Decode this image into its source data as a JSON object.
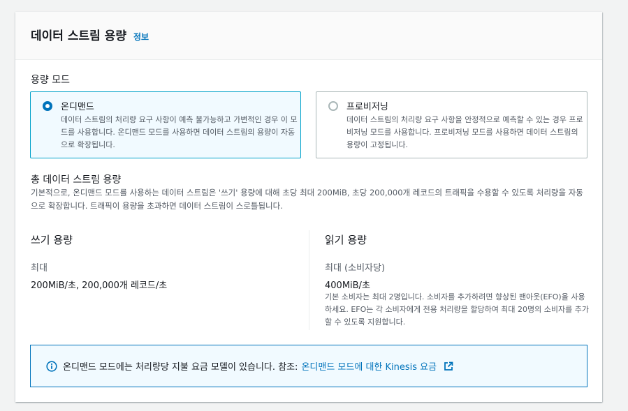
{
  "panel": {
    "title": "데이터 스트림 용량",
    "info_link": "정보"
  },
  "capacity_mode": {
    "label": "용량 모드",
    "options": [
      {
        "title": "온디맨드",
        "description": "데이터 스트림의 처리량 요구 사항이 예측 불가능하고 가변적인 경우 이 모드를 사용합니다. 온디맨드 모드를 사용하면 데이터 스트림의 용량이 자동으로 확장됩니다.",
        "selected": true
      },
      {
        "title": "프로비저닝",
        "description": "데이터 스트림의 처리량 요구 사항을 안정적으로 예측할 수 있는 경우 프로비저닝 모드를 사용합니다. 프로비저닝 모드를 사용하면 데이터 스트림의 용량이 고정됩니다.",
        "selected": false
      }
    ]
  },
  "total_capacity": {
    "title": "총 데이터 스트림 용량",
    "description": "기본적으로, 온디맨드 모드를 사용하는 데이터 스트림은 '쓰기' 용량에 대해 초당 최대 200MiB, 초당 200,000개 레코드의 트래픽을 수용할 수 있도록 처리량을 자동으로 확장합니다. 트래픽이 용량을 초과하면 데이터 스트림이 스로틀됩니다."
  },
  "write_capacity": {
    "title": "쓰기 용량",
    "label": "최대",
    "value": "200MiB/초, 200,000개 레코드/초"
  },
  "read_capacity": {
    "title": "읽기 용량",
    "label": "최대 (소비자당)",
    "value": "400MiB/초",
    "note": "기본 소비자는 최대 2명입니다. 소비자를 추가하려면 향상된 팬아웃(EFO)을 사용하세요. EFO는 각 소비자에게 전용 처리량을 할당하여 최대 20명의 소비자를 추가할 수 있도록 지원합니다."
  },
  "alert": {
    "icon": "info-icon",
    "text": "온디맨드 모드에는 처리량당 지불 요금 모델이 있습니다. 참조:",
    "link": "온디맨드 모드에 대한 Kinesis 요금",
    "link_icon": "external-link-icon"
  },
  "colors": {
    "accent": "#0073bb",
    "selected_border": "#00a1c9",
    "selected_bg": "#f1faff"
  }
}
